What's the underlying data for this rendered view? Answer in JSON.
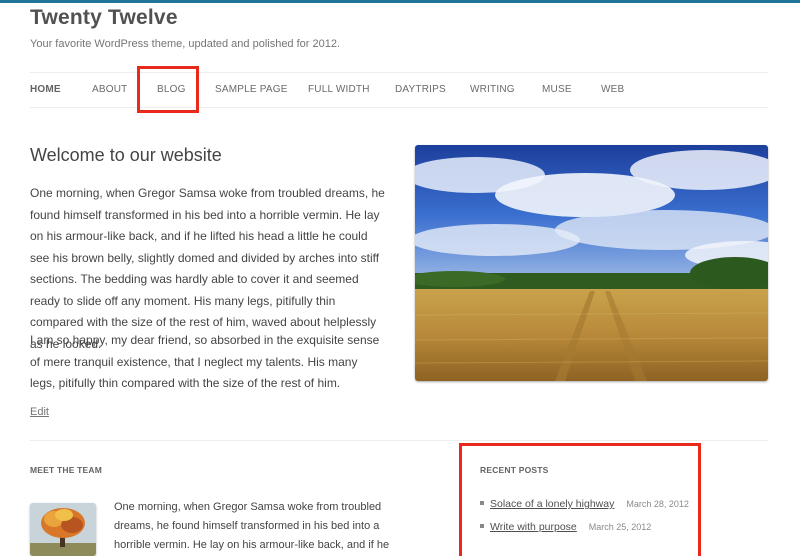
{
  "site": {
    "title": "Twenty Twelve",
    "description": "Your favorite WordPress theme, updated and polished for 2012."
  },
  "nav": {
    "items": [
      {
        "label": "HOME",
        "current": true
      },
      {
        "label": "ABOUT"
      },
      {
        "label": "BLOG"
      },
      {
        "label": "SAMPLE PAGE"
      },
      {
        "label": "FULL WIDTH"
      },
      {
        "label": "DAYTRIPS"
      },
      {
        "label": "WRITING"
      },
      {
        "label": "MUSE"
      },
      {
        "label": "WEB"
      }
    ]
  },
  "page": {
    "title": "Welcome to our website",
    "paragraph1": "One morning, when Gregor Samsa woke from troubled dreams, he found himself transformed in his bed into a horrible vermin. He lay on his armour-like back, and if he lifted his head a little he could see his brown belly, slightly domed and divided by arches into stiff sections. The bedding was hardly able to cover it and seemed ready to slide off any moment. His many legs, pitifully thin compared with the size of the rest of him, waved about helplessly as he looked.",
    "paragraph2": "I am so happy, my dear friend, so absorbed in the exquisite sense of mere tranquil existence, that I neglect my talents. His many legs, pitifully thin compared with the size of the rest of him.",
    "edit_label": "Edit"
  },
  "team_widget": {
    "title": "MEET THE TEAM",
    "text": "One morning, when Gregor Samsa woke from troubled dreams, he found himself transformed in his bed into a horrible vermin. He lay on his armour-like back, and if he lifted his head a little he"
  },
  "recent_posts": {
    "title": "RECENT POSTS",
    "items": [
      {
        "title": "Solace of a lonely highway",
        "date": "March 28, 2012"
      },
      {
        "title": "Write with purpose",
        "date": "March 25, 2012"
      }
    ]
  },
  "colors": {
    "accent": "#21759b",
    "highlight": "#e8291c"
  },
  "icons": {
    "hero_image": "wheat-field-photo",
    "team_image": "autumn-tree-photo"
  }
}
